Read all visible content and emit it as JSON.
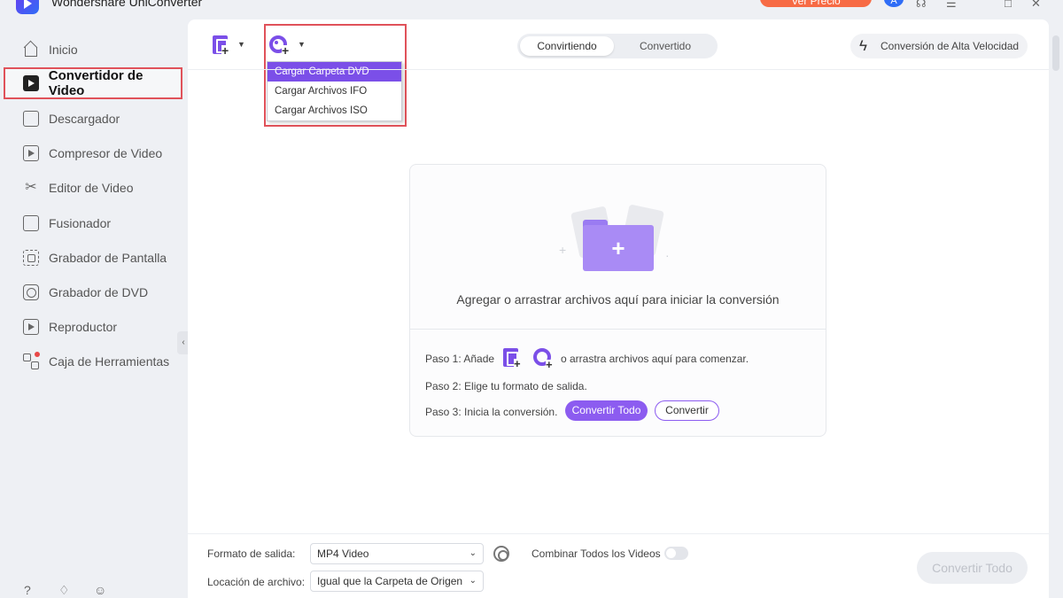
{
  "window": {
    "title": "Wondershare UniConverter",
    "trial_label": "Ver Precio",
    "avatar_letter": "A",
    "icons": [
      "headset-icon",
      "menu-icon",
      "minimize-icon",
      "maximize-icon",
      "close-icon"
    ]
  },
  "sidebar": {
    "items": [
      {
        "label": "Inicio",
        "icon": "home-icon"
      },
      {
        "label": "Convertidor de Video",
        "icon": "video-converter-icon",
        "active": true
      },
      {
        "label": "Descargador",
        "icon": "download-icon"
      },
      {
        "label": "Compresor de Video",
        "icon": "compress-icon"
      },
      {
        "label": "Editor de Video",
        "icon": "scissors-icon"
      },
      {
        "label": "Fusionador",
        "icon": "merge-icon"
      },
      {
        "label": "Grabador de Pantalla",
        "icon": "screen-record-icon"
      },
      {
        "label": "Grabador de DVD",
        "icon": "dvd-burner-icon"
      },
      {
        "label": "Reproductor",
        "icon": "player-icon"
      },
      {
        "label": "Caja de Herramientas",
        "icon": "toolbox-icon"
      }
    ],
    "bottom_icons": [
      "help-icon",
      "bell-icon",
      "feedback-icon"
    ]
  },
  "toolbar": {
    "dropdown_items": [
      "Cargar Carpeta DVD",
      "Cargar Archivos IFO",
      "Cargar Archivos ISO"
    ],
    "tabs": [
      "Convirtiendo",
      "Convertido"
    ],
    "fast_conversion_label": "Conversión de Alta Velocidad"
  },
  "dropzone": {
    "main_text": "Agregar o arrastrar archivos aquí para iniciar la conversión",
    "step1_prefix": "Paso 1: Añade",
    "step1_suffix": "o arrastra archivos aquí para comenzar.",
    "step2": "Paso 2: Elige tu formato de salida.",
    "step3": "Paso 3: Inicia la conversión.",
    "convert_all_label": "Convertir Todo",
    "convert_label": "Convertir"
  },
  "bottom": {
    "format_label": "Formato de salida:",
    "format_value": "MP4 Video",
    "location_label": "Locación de archivo:",
    "location_value": "Igual que la Carpeta de Origen",
    "combine_label": "Combinar Todos los Videos",
    "combine_enabled": false,
    "convert_all_label": "Convertir Todo"
  },
  "colors": {
    "accent": "#8c5cf0",
    "highlight": "#e0525a",
    "trial": "#f76b45"
  }
}
